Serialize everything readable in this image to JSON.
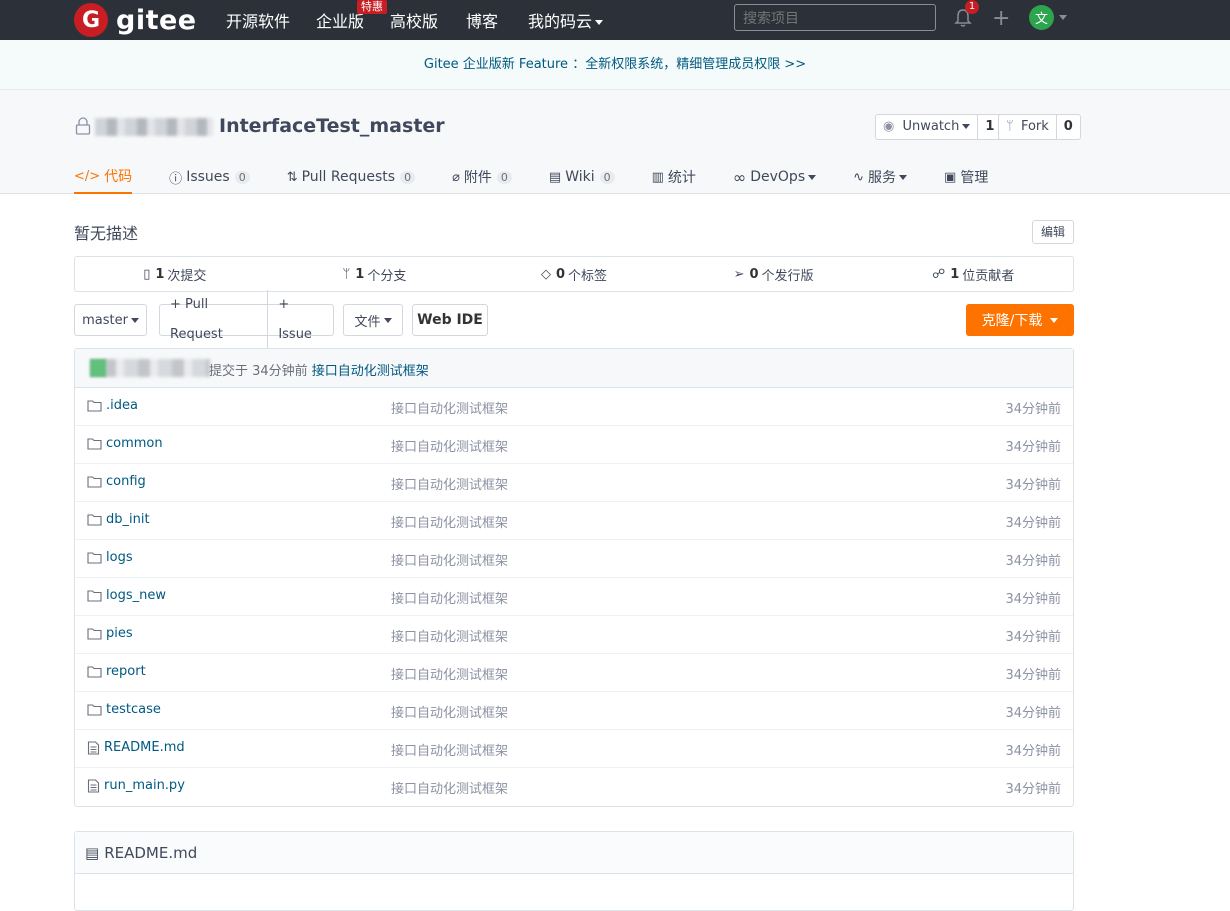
{
  "nav": {
    "logo_letter": "G",
    "logo_text": "gitee",
    "items": [
      "开源软件",
      "企业版",
      "高校版",
      "博客",
      "我的码云"
    ],
    "special_badge": "特惠",
    "search_placeholder": "搜索项目",
    "notification_count": "1",
    "avatar_letter": "文"
  },
  "banner": {
    "text": "Gitee 企业版新 Feature ：全新权限系统，精细管理成员权限 >>"
  },
  "repo": {
    "name": "InterfaceTest_master",
    "unwatch_label": "Unwatch",
    "watch_count": "1",
    "fork_label": "Fork",
    "fork_count": "0"
  },
  "tabs": [
    {
      "label": "代码",
      "count": ""
    },
    {
      "label": "Issues",
      "count": "0"
    },
    {
      "label": "Pull Requests",
      "count": "0"
    },
    {
      "label": "附件",
      "count": "0"
    },
    {
      "label": "Wiki",
      "count": "0"
    },
    {
      "label": "统计",
      "count": ""
    },
    {
      "label": "DevOps",
      "count": ""
    },
    {
      "label": "服务",
      "count": ""
    },
    {
      "label": "管理",
      "count": ""
    }
  ],
  "description": "暂无描述",
  "edit_label": "编辑",
  "stats": [
    {
      "num": "1",
      "label": "次提交"
    },
    {
      "num": "1",
      "label": "个分支"
    },
    {
      "num": "0",
      "label": "个标签"
    },
    {
      "num": "0",
      "label": "个发行版"
    },
    {
      "num": "1",
      "label": "位贡献者"
    }
  ],
  "toolbar": {
    "branch": "master",
    "pull_request": "+ Pull Request",
    "issue": "+ Issue",
    "file": "文件",
    "web_ide": "Web IDE",
    "clone": "克隆/下载"
  },
  "commit": {
    "text": "提交于 34分钟前",
    "message": "接口自动化测试框架"
  },
  "files": [
    {
      "name": ".idea",
      "type": "folder",
      "message": "接口自动化测试框架",
      "time": "34分钟前"
    },
    {
      "name": "common",
      "type": "folder",
      "message": "接口自动化测试框架",
      "time": "34分钟前"
    },
    {
      "name": "config",
      "type": "folder",
      "message": "接口自动化测试框架",
      "time": "34分钟前"
    },
    {
      "name": "db_init",
      "type": "folder",
      "message": "接口自动化测试框架",
      "time": "34分钟前"
    },
    {
      "name": "logs",
      "type": "folder",
      "message": "接口自动化测试框架",
      "time": "34分钟前"
    },
    {
      "name": "logs_new",
      "type": "folder",
      "message": "接口自动化测试框架",
      "time": "34分钟前"
    },
    {
      "name": "pies",
      "type": "folder",
      "message": "接口自动化测试框架",
      "time": "34分钟前"
    },
    {
      "name": "report",
      "type": "folder",
      "message": "接口自动化测试框架",
      "time": "34分钟前"
    },
    {
      "name": "testcase",
      "type": "folder",
      "message": "接口自动化测试框架",
      "time": "34分钟前"
    },
    {
      "name": "README.md",
      "type": "file",
      "message": "接口自动化测试框架",
      "time": "34分钟前"
    },
    {
      "name": "run_main.py",
      "type": "file",
      "message": "接口自动化测试框架",
      "time": "34分钟前"
    }
  ],
  "readme": {
    "title": "README.md"
  }
}
